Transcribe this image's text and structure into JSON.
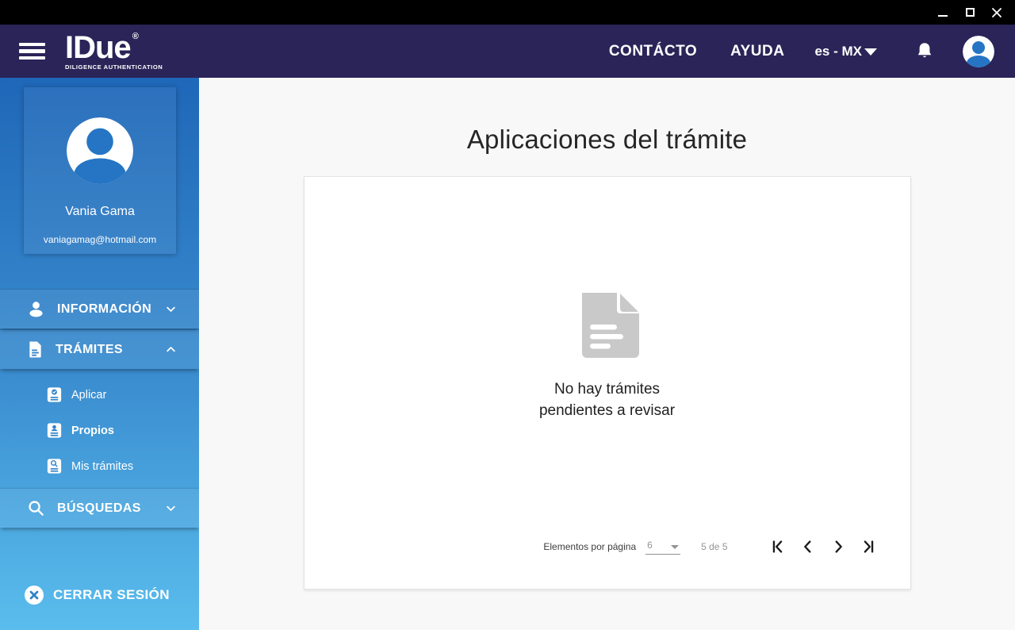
{
  "header": {
    "logo_text": "IDue",
    "logo_registered": "®",
    "logo_subtitle": "DILIGENCE AUTHENTICATION",
    "nav": [
      {
        "label": "CONTÁCTO"
      },
      {
        "label": "AYUDA"
      }
    ],
    "language_selector": {
      "value": "es - MX"
    },
    "icons": {
      "menu": "hamburger-icon",
      "notifications": "bell-icon",
      "account": "user-avatar-icon"
    }
  },
  "sidebar": {
    "profile": {
      "name": "Vania Gama",
      "email": "vaniagamag@hotmail.com"
    },
    "menu": [
      {
        "label": "INFORMACIÓN",
        "icon": "person-icon",
        "state": "collapsed"
      },
      {
        "label": "TRÁMITES",
        "icon": "document-icon",
        "state": "expanded"
      },
      {
        "label": "BÚSQUEDAS",
        "icon": "search-icon",
        "state": "collapsed"
      }
    ],
    "submenu": [
      {
        "label": "Aplicar",
        "icon": "document-check-icon",
        "active": false
      },
      {
        "label": "Propios",
        "icon": "document-person-icon",
        "active": true
      },
      {
        "label": "Mis trámites",
        "icon": "document-search-icon",
        "active": false
      }
    ],
    "logout": {
      "label": "CERRAR SESIÓN",
      "icon": "close-circle-icon"
    }
  },
  "main": {
    "title": "Aplicaciones del trámite",
    "empty_state": {
      "icon": "document-icon",
      "message_line1": "No hay trámites",
      "message_line2": "pendientes a revisar"
    },
    "pagination": {
      "items_per_page_label": "Elementos por página",
      "items_per_page_value": "6",
      "range_label": "5 de 5"
    }
  },
  "colors": {
    "titlebar_bg": "#000000",
    "header_bg": "#2a2458",
    "sidebar_gradient_top": "#1f67b8",
    "sidebar_gradient_bottom": "#5abded",
    "accent_blue": "#2575c4",
    "main_bg": "#f8f8f8",
    "card_bg": "#ffffff",
    "empty_icon_gray": "#c9c9c9",
    "pagination_gray": "#949494"
  }
}
